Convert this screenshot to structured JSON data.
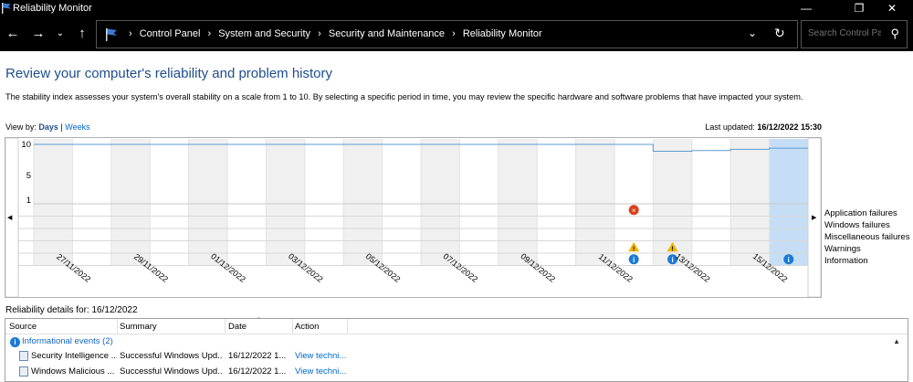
{
  "window": {
    "title": "Reliability Monitor"
  },
  "address": {
    "crumbs": [
      "Control Panel",
      "System and Security",
      "Security and Maintenance",
      "Reliability Monitor"
    ],
    "search_placeholder": "Search Control Pa..."
  },
  "page": {
    "heading": "Review your computer's reliability and problem history",
    "description": "The stability index assesses your system's overall stability on a scale from 1 to 10. By selecting a specific period in time, you may review the specific hardware and software problems that have impacted your system.",
    "view_by_label": "View by:",
    "view_days": "Days",
    "view_sep": "|",
    "view_weeks": "Weeks",
    "last_updated_label": "Last updated:",
    "last_updated_value": "16/12/2022 15:30"
  },
  "chart_data": {
    "type": "line",
    "y_ticks": [
      "10",
      "5",
      "1"
    ],
    "x_tick_labels": [
      "27/11/2022",
      "29/11/2022",
      "01/12/2022",
      "03/12/2022",
      "05/12/2022",
      "07/12/2022",
      "09/12/2022",
      "11/12/2022",
      "13/12/2022",
      "15/12/2022"
    ],
    "columns": 20,
    "selected_column": 19,
    "stability_index": [
      10,
      10,
      10,
      10,
      10,
      10,
      10,
      10,
      10,
      10,
      10,
      10,
      10,
      10,
      10,
      10,
      8.9,
      9.0,
      9.2,
      9.4
    ],
    "legend": [
      "Application failures",
      "Windows failures",
      "Miscellaneous failures",
      "Warnings",
      "Information"
    ],
    "events": [
      {
        "column": 15,
        "type": "Application failures"
      },
      {
        "column": 15,
        "type": "Warnings"
      },
      {
        "column": 16,
        "type": "Warnings"
      },
      {
        "column": 15,
        "type": "Information"
      },
      {
        "column": 16,
        "type": "Information"
      },
      {
        "column": 19,
        "type": "Information"
      }
    ]
  },
  "details": {
    "title": "Reliability details for: 16/12/2022",
    "columns": {
      "source": "Source",
      "summary": "Summary",
      "date": "Date",
      "action": "Action"
    },
    "group": "Informational events (2)",
    "rows": [
      {
        "source": "Security Intelligence ...",
        "summary": "Successful Windows Upd...",
        "date": "16/12/2022 1...",
        "action": "View techni..."
      },
      {
        "source": "Windows Malicious ...",
        "summary": "Successful Windows Upd...",
        "date": "16/12/2022 1...",
        "action": "View techni..."
      }
    ]
  },
  "colors": {
    "accent": "#1e4e8c",
    "link": "#0066cc",
    "selected": "#c5def5",
    "error": "#d9411e",
    "warning": "#f0b400",
    "info": "#1a7ad6"
  }
}
